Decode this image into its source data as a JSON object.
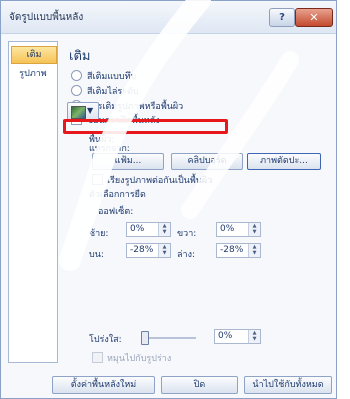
{
  "dialog": {
    "title": "จัดรูปแบบพื้นหลัง",
    "help_label": "?",
    "close_label": "✕"
  },
  "sidebar": {
    "items": [
      {
        "label": "เติม",
        "selected": true
      },
      {
        "label": "รูปภาพ",
        "selected": false
      }
    ]
  },
  "fill": {
    "section_title": "เติม",
    "options": [
      {
        "label": "สีเติมแบบทึบ",
        "selected": false
      },
      {
        "label": "สีเติมไล่ระดับ",
        "selected": false
      },
      {
        "label": "การเติมรูปภาพหรือพื้นผิว",
        "selected": true
      }
    ],
    "hide_bg_graphics": "ซ่อนกราฟิกพื้นหลัง",
    "texture_label": "พื้นผิว:",
    "insert_from_label": "แทรกจาก:",
    "file_button": "แฟ้ม...",
    "clipboard_button": "คลิปบอร์ด",
    "clipart_button": "ภาพตัดปะ...",
    "tile_checkbox": "เรียงรูปภาพต่อกันเป็นพื้นผิว",
    "stretch_options_label": "ตัวเลือกการยืด",
    "offsets_label": "ออฟเซ็ต:",
    "left_label": "ซ้าย:",
    "left_value": "0%",
    "right_label": "ขวา:",
    "right_value": "0%",
    "top_label": "บน:",
    "top_value": "-28%",
    "bottom_label": "ล่าง:",
    "bottom_value": "-28%",
    "transparency_label": "โปร่งใส:",
    "transparency_value": "0%",
    "transparency_level": 0,
    "rotate_with_shape": "หมุนไปกับรูปร่าง"
  },
  "footer": {
    "reset_button": "ตั้งค่าพื้นหลังใหม่",
    "close_button": "ปิด",
    "apply_all_button": "นำไปใช้กับทั้งหมด"
  },
  "colors": {
    "highlight": "#e8171c",
    "selected_tab": "#f6c355"
  }
}
